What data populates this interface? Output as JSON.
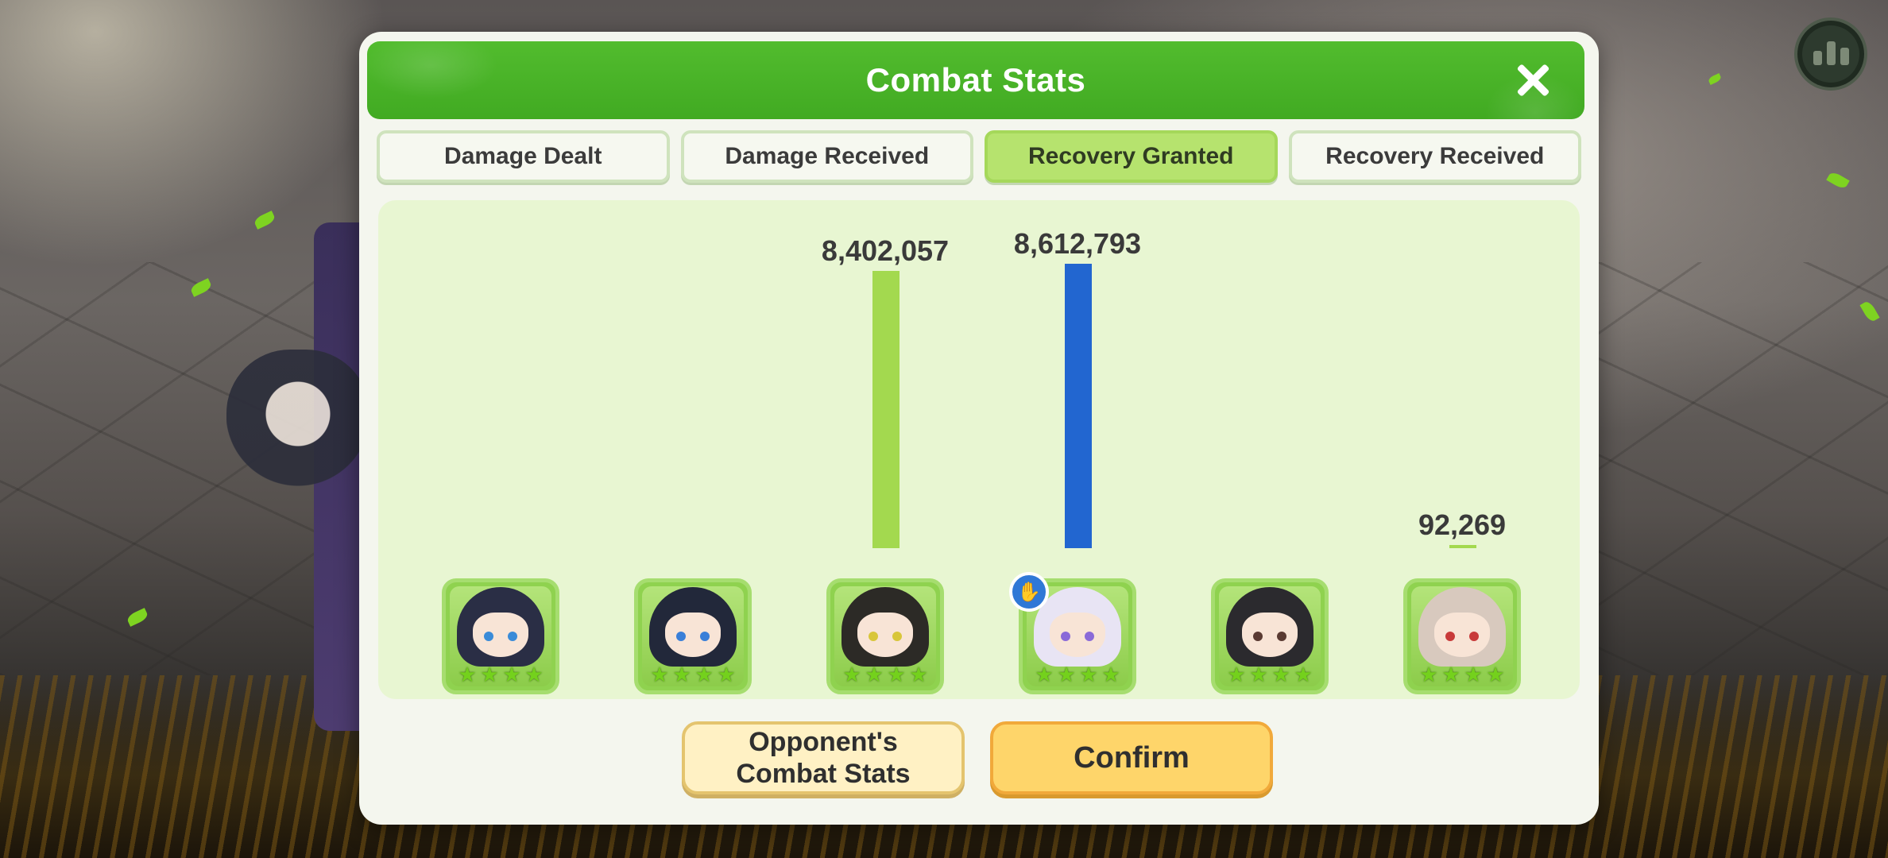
{
  "dialog": {
    "title": "Combat Stats",
    "close_icon": "close-icon"
  },
  "tabs": [
    {
      "label": "Damage Dealt",
      "active": false
    },
    {
      "label": "Damage Received",
      "active": false
    },
    {
      "label": "Recovery Granted",
      "active": true
    },
    {
      "label": "Recovery Received",
      "active": false
    }
  ],
  "chart_data": {
    "type": "bar",
    "categories": [
      "hero-1",
      "hero-2",
      "hero-3",
      "hero-4",
      "hero-5",
      "hero-6"
    ],
    "values": [
      0,
      0,
      8402057,
      8612793,
      0,
      92269
    ],
    "value_labels": [
      "",
      "",
      "8,402,057",
      "8,612,793",
      "",
      "92,269"
    ],
    "bar_colors": [
      "#a3d94f",
      "#a3d94f",
      "#a3d94f",
      "#2266d0",
      "#a3d94f",
      "#a3d94f"
    ],
    "highlight_index": 3,
    "xlabel": "",
    "ylabel": ""
  },
  "heroes": [
    {
      "stars": 4,
      "hair": "#2a2e45",
      "eye": "#3a8bd8"
    },
    {
      "stars": 4,
      "hair": "#22283a",
      "eye": "#3a7fd8"
    },
    {
      "stars": 4,
      "hair": "#2c2a26",
      "eye": "#d8c63a"
    },
    {
      "stars": 4,
      "hair": "#e8e4f4",
      "eye": "#8a6ad8",
      "badge": "thumbs-up-icon"
    },
    {
      "stars": 4,
      "hair": "#2b2a2e",
      "eye": "#5a3a32"
    },
    {
      "stars": 4,
      "hair": "#d8c9be",
      "eye": "#c83a3a"
    }
  ],
  "footer": {
    "opponent_label_line1": "Opponent's",
    "opponent_label_line2": "Combat Stats",
    "confirm_label": "Confirm"
  },
  "hud": {
    "stats_icon": "bar-chart-icon"
  },
  "colors": {
    "header_green": "#45ad25",
    "active_tab": "#b6e36e",
    "chart_bg": "#e8f6d2",
    "confirm_yellow": "#fed56a"
  }
}
